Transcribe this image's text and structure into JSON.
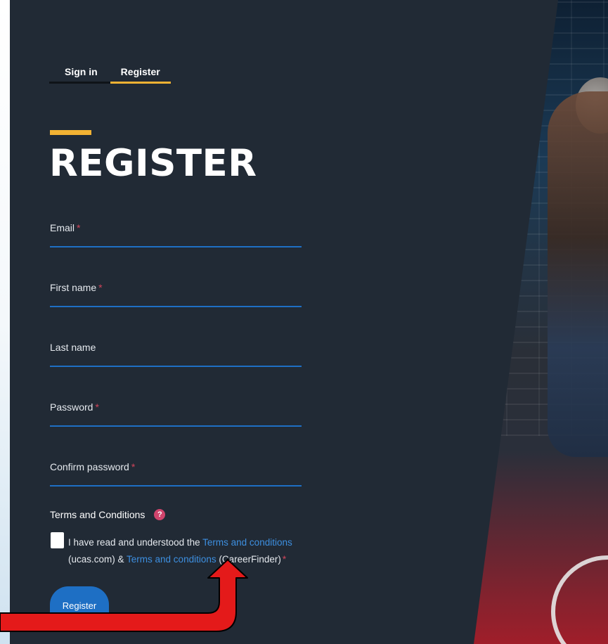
{
  "tabs": {
    "signin_label": "Sign in",
    "register_label": "Register"
  },
  "title": "REGISTER",
  "fields": {
    "email": {
      "label": "Email",
      "required": "*"
    },
    "first_name": {
      "label": "First name",
      "required": "*"
    },
    "last_name": {
      "label": "Last name"
    },
    "password": {
      "label": "Password",
      "required": "*"
    },
    "confirm_password": {
      "label": "Confirm password",
      "required": "*"
    }
  },
  "terms": {
    "heading": "Terms and Conditions",
    "help_icon": "?",
    "text_before": "I have read and understood the ",
    "link1": "Terms and conditions",
    "text_middle": " (ucas.com) & ",
    "link2": "Terms and conditions",
    "text_after": " (CareerFinder)",
    "required": "*"
  },
  "register_button": "Register",
  "colors": {
    "panel_bg": "#212a35",
    "accent": "#f2b233",
    "field_line": "#1e6fc4",
    "link": "#3d8fe0",
    "required": "#d0445a",
    "annotation_arrow": "#e41a1a"
  }
}
